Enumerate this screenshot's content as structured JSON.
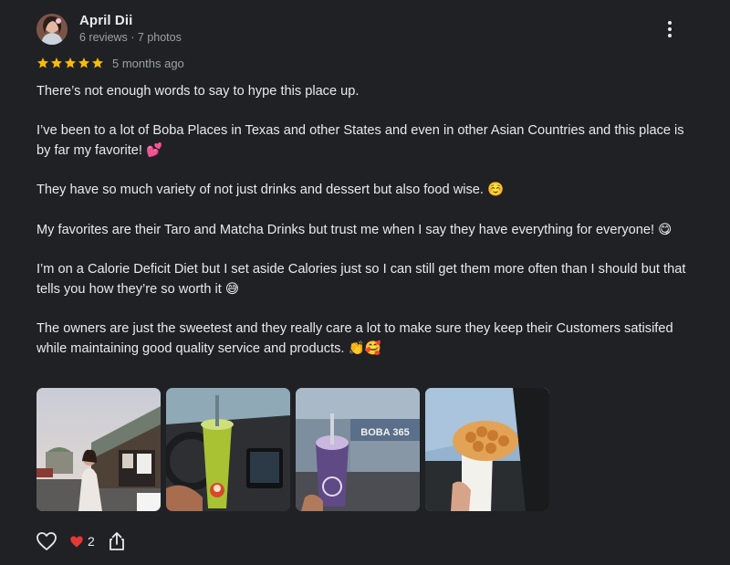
{
  "reviewer": {
    "name": "April Dii",
    "meta": "6 reviews · 7 photos"
  },
  "rating": {
    "stars": 5,
    "max": 5,
    "star_color": "#fbbc04",
    "date": "5 months ago"
  },
  "review": {
    "paragraphs": [
      "There’s not enough words to say to hype this place up.",
      "I’ve been to a lot of Boba Places in Texas and other States and even in other Asian Countries and this place is by far my favorite! 💕",
      "They have so much variety of not just drinks and dessert but also food wise. ☺️",
      "My favorites are their Taro and Matcha Drinks but trust me when I say they have everything for everyone! 😋",
      "I’m on a Calorie Deficit Diet but I set aside Calories just so I can still get them more often than I should but that tells you how they’re so worth it 😅",
      "The owners are just the sweetest and they really care a lot to make sure they keep their Customers satisifed while maintaining good quality service and products. 👏🥰"
    ]
  },
  "photos": [
    {
      "name": "photo-storefront"
    },
    {
      "name": "photo-matcha-drink"
    },
    {
      "name": "photo-taro-drink",
      "sign_text": "BOBA 365"
    },
    {
      "name": "photo-bubble-waffle"
    }
  ],
  "actions": {
    "reaction_emoji": "❤️",
    "reaction_count": "2"
  },
  "icons": {
    "more": "more-vert-icon",
    "like": "heart-outline-icon",
    "share": "share-icon"
  },
  "colors": {
    "background": "#202124",
    "text": "#e8eaed",
    "secondary_text": "#9aa0a6"
  }
}
